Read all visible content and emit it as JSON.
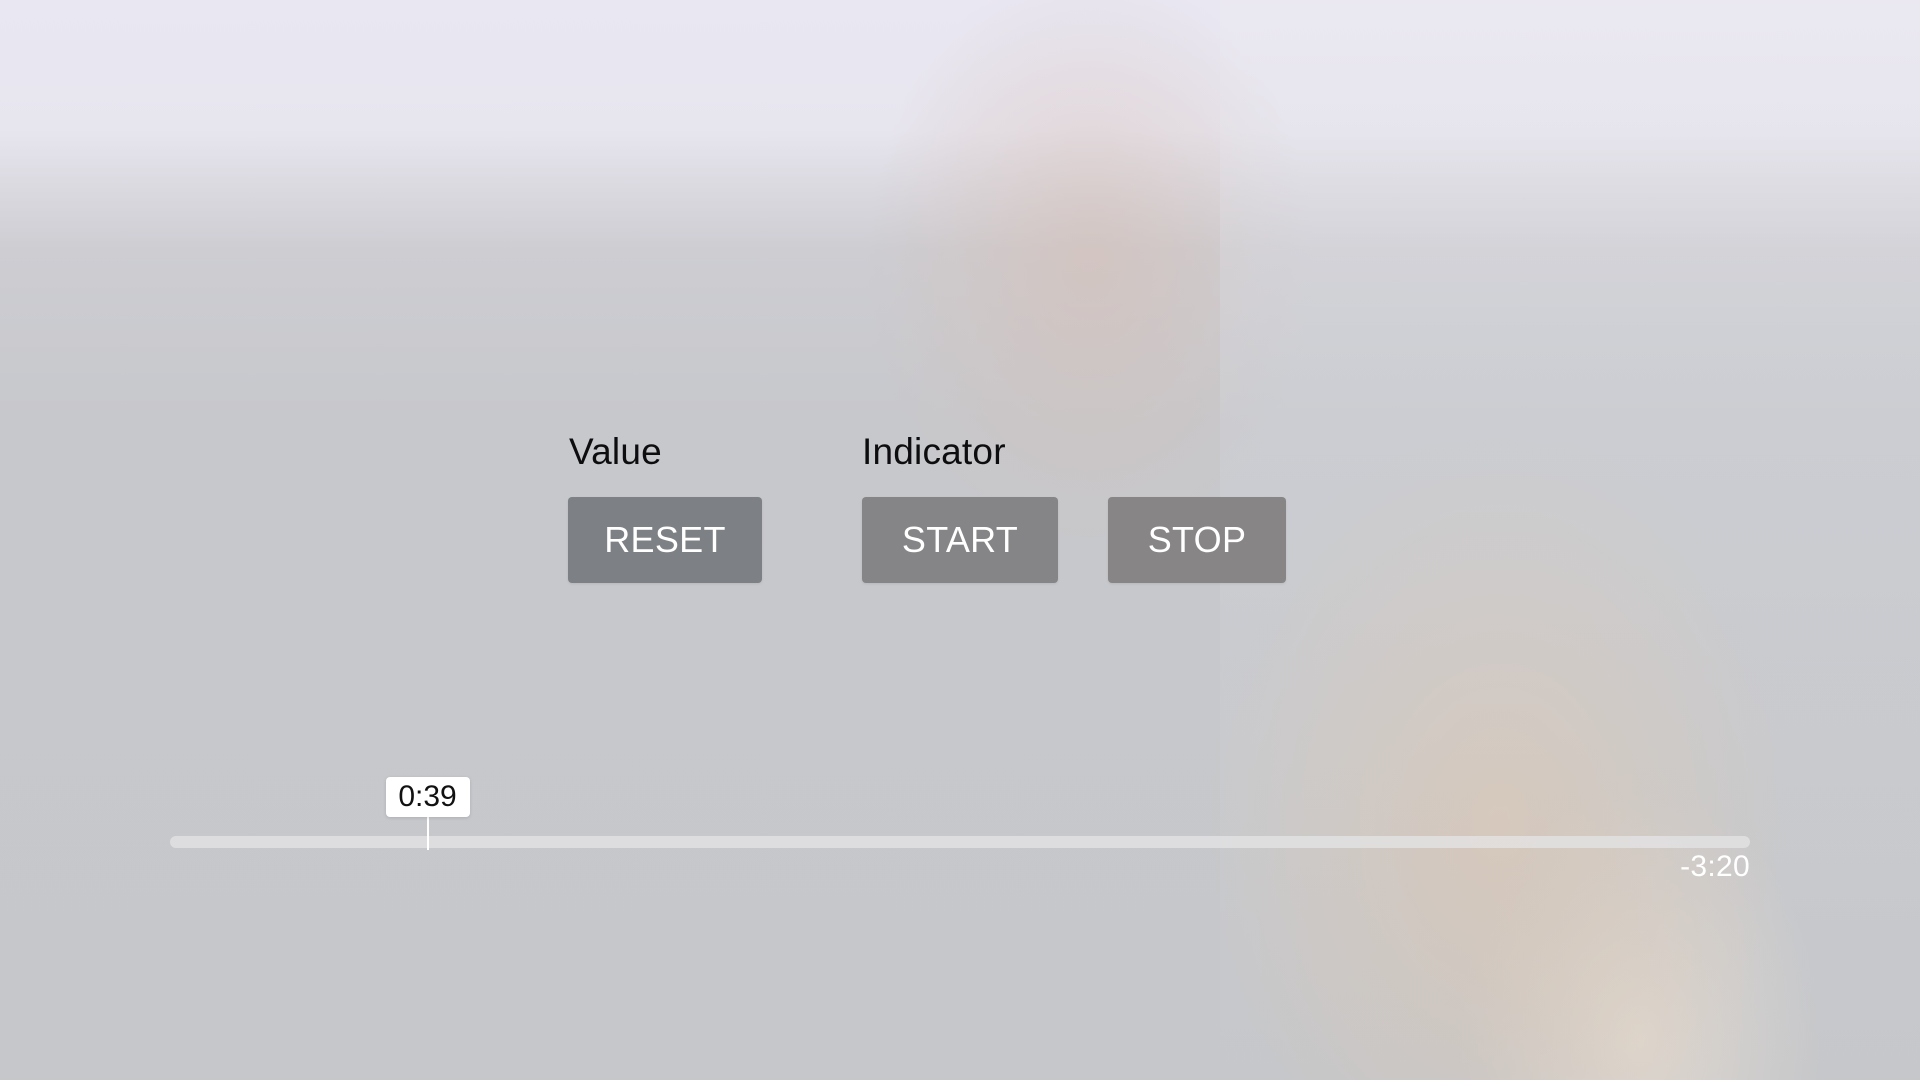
{
  "sections": {
    "value": {
      "label": "Value",
      "reset_label": "RESET"
    },
    "indicator": {
      "label": "Indicator",
      "start_label": "START",
      "stop_label": "STOP"
    }
  },
  "playback": {
    "current_time": "0:39",
    "remaining_time": "-3:20",
    "progress_fraction": 0.163
  },
  "colors": {
    "button_reset": "#7d8084",
    "button_indicator": "#858486",
    "button_text": "#ffffff",
    "time_bubble": "#ffffff"
  }
}
